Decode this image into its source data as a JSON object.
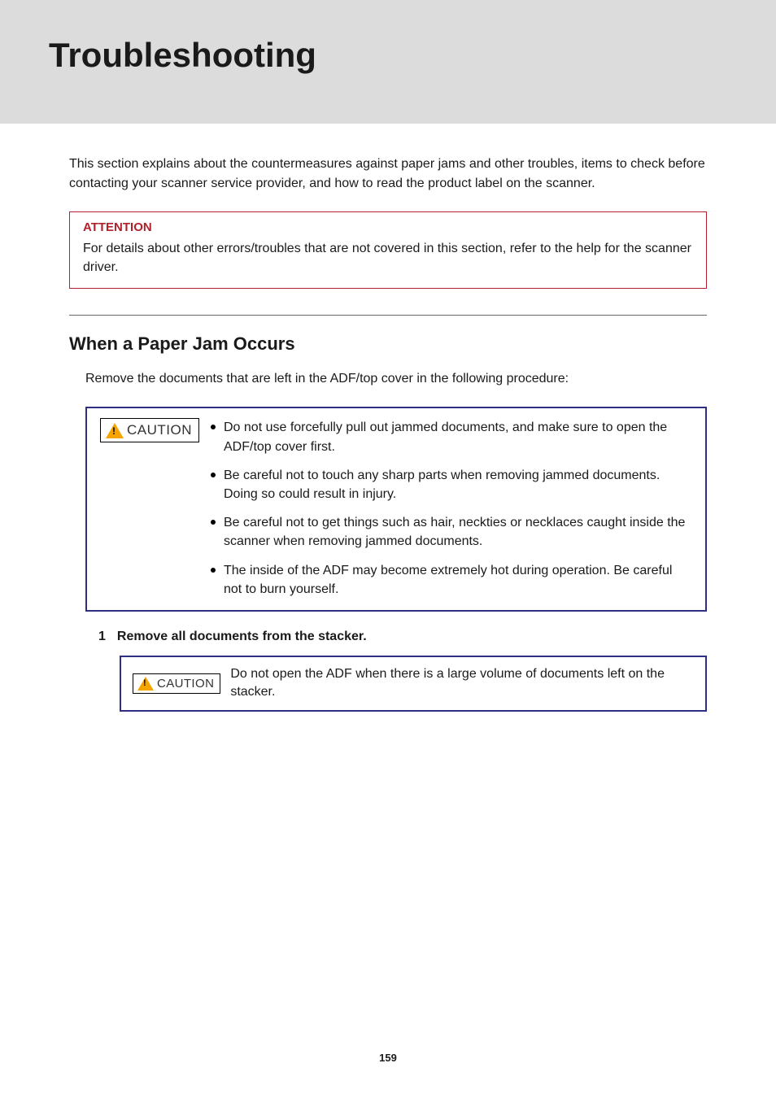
{
  "header": {
    "title": "Troubleshooting"
  },
  "intro": "This section explains about the countermeasures against paper jams and other troubles, items to check before contacting your scanner service provider, and how to read the product label on the scanner.",
  "attention": {
    "label": "ATTENTION",
    "text": "For details about other errors/troubles that are not covered in this section, refer to the help for the scanner driver."
  },
  "section": {
    "heading": "When a Paper Jam Occurs",
    "intro": "Remove the documents that are left in the ADF/top cover in the following procedure:"
  },
  "caution_badge": "CAUTION",
  "caution_items": [
    "Do not use forcefully pull out jammed documents, and make sure to open the ADF/top cover first.",
    "Be careful not to touch any sharp parts when removing jammed documents. Doing so could result in injury.",
    "Be careful not to get things such as hair, neckties or necklaces caught inside the scanner when removing jammed documents.",
    "The inside of the ADF may become extremely hot during operation. Be careful not to burn yourself."
  ],
  "step1": {
    "number": "1",
    "text": "Remove all documents from the stacker.",
    "caution_badge": "CAUTION",
    "caution_text": "Do not open the ADF when there is a large volume of documents left on the stacker."
  },
  "page_number": "159"
}
